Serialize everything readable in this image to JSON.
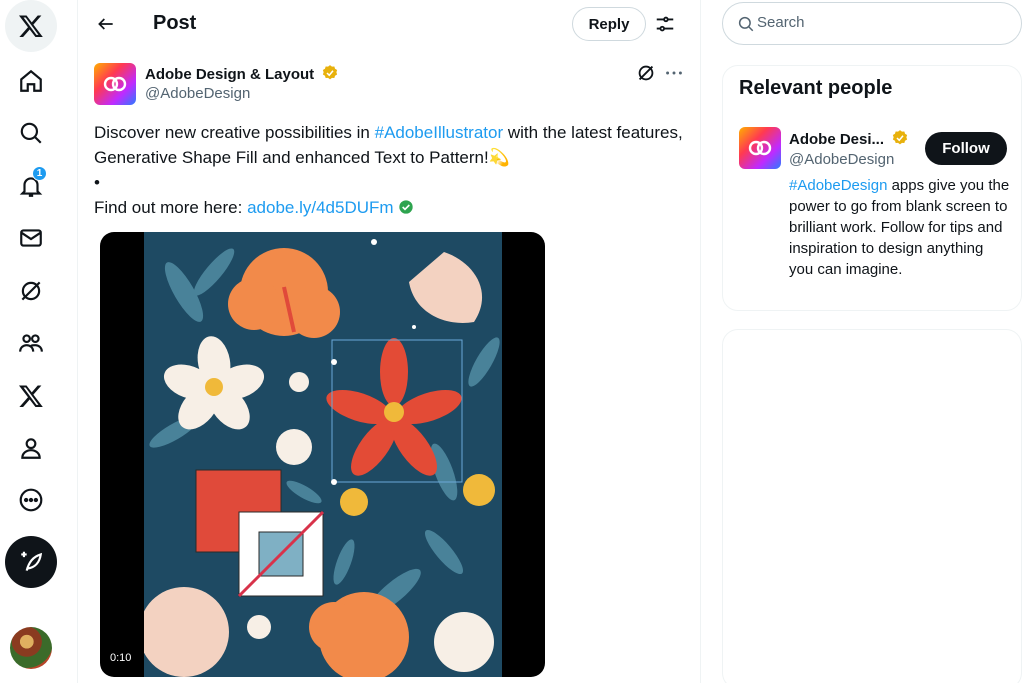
{
  "header": {
    "title": "Post",
    "reply_label": "Reply"
  },
  "nav": {
    "notification_count": "1"
  },
  "tweet": {
    "author_name": "Adobe Design & Layout",
    "author_handle": "@AdobeDesign",
    "text_part1": "Discover new creative possibilities in ",
    "hashtag": "#AdobeIllustrator",
    "text_part2": " with the latest features, Generative Shape Fill and enhanced Text to Pattern!",
    "emoji": "💫",
    "bullet": "•",
    "link_prefix": "Find out more here: ",
    "link": "adobe.ly/4d5DUFm",
    "video_time": "0:10"
  },
  "search": {
    "placeholder": "Search"
  },
  "relevant_people": {
    "title": "Relevant people",
    "name": "Adobe Desi...",
    "handle": "@AdobeDesign",
    "follow_label": "Follow",
    "bio_hashtag": "#AdobeDesign",
    "bio_text": " apps give you the power to go from blank screen to brilliant work. Follow for tips and inspiration to design anything you can imagine."
  },
  "colors": {
    "accent": "#1d9bf0",
    "text": "#0f1419",
    "muted": "#536471",
    "verified": "#f4c20d"
  },
  "icons": [
    "x-logo-icon",
    "home-icon",
    "explore-icon",
    "notifications-icon",
    "messages-icon",
    "grok-icon",
    "communities-icon",
    "premium-icon",
    "profile-icon",
    "more-icon",
    "compose-icon",
    "back-arrow-icon",
    "filter-icon",
    "verified-badge-icon",
    "search-icon"
  ]
}
